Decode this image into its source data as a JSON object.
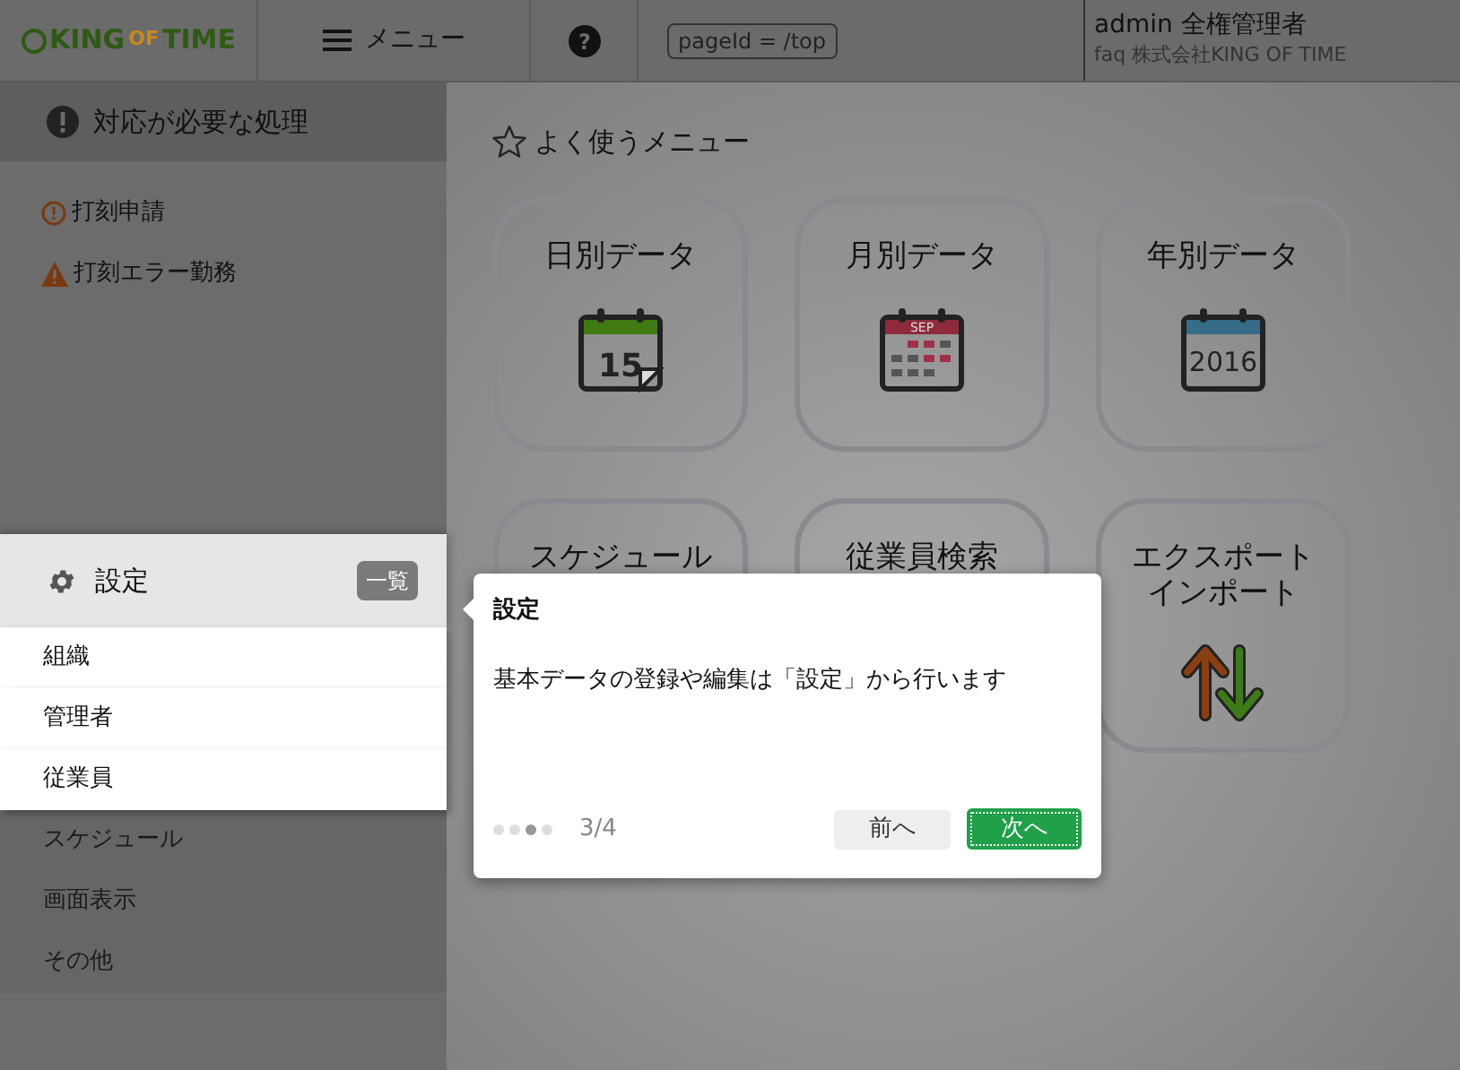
{
  "header": {
    "logo": {
      "part_1": "KING",
      "part_2": "OF",
      "part_3": "TIME"
    },
    "menu_button": "メニュー",
    "help_glyph": "?",
    "page_id": "pageId = /top",
    "user": "admin 全権管理者",
    "company": "faq 株式会社KING OF TIME"
  },
  "alerts": {
    "title": "対応が必要な処理",
    "items": [
      {
        "kind": "info",
        "label": "打刻申請"
      },
      {
        "kind": "warning",
        "label": "打刻エラー勤務"
      }
    ]
  },
  "settings": {
    "title": "設定",
    "badge": "一覧",
    "items": [
      {
        "label": "組織",
        "highlighted": true
      },
      {
        "label": "管理者",
        "highlighted": true
      },
      {
        "label": "従業員",
        "highlighted": true
      },
      {
        "label": "スケジュール",
        "highlighted": false
      },
      {
        "label": "画面表示",
        "highlighted": false
      },
      {
        "label": "その他",
        "highlighted": false
      }
    ]
  },
  "favorites": {
    "title": "よく使うメニュー",
    "cards": [
      {
        "lines": [
          "日別データ"
        ],
        "kind": "day",
        "icon_text": "15"
      },
      {
        "lines": [
          "月別データ"
        ],
        "kind": "month",
        "icon_text": "SEP"
      },
      {
        "lines": [
          "年別データ"
        ],
        "kind": "year",
        "icon_text": "2016"
      },
      {
        "lines": [
          "スケジュール"
        ],
        "kind": "plain"
      },
      {
        "lines": [
          "従業員検索"
        ],
        "kind": "plain"
      },
      {
        "lines": [
          "エクスポート",
          "インポート"
        ],
        "kind": "transfer"
      }
    ]
  },
  "tour": {
    "title": "設定",
    "body": "基本データの登録や編集は「設定」から行います",
    "dots": [
      {
        "selected": false
      },
      {
        "selected": false
      },
      {
        "selected": true
      },
      {
        "selected": false
      }
    ],
    "step": "3/4",
    "prev_button": "前へ",
    "next_button": "次へ"
  }
}
